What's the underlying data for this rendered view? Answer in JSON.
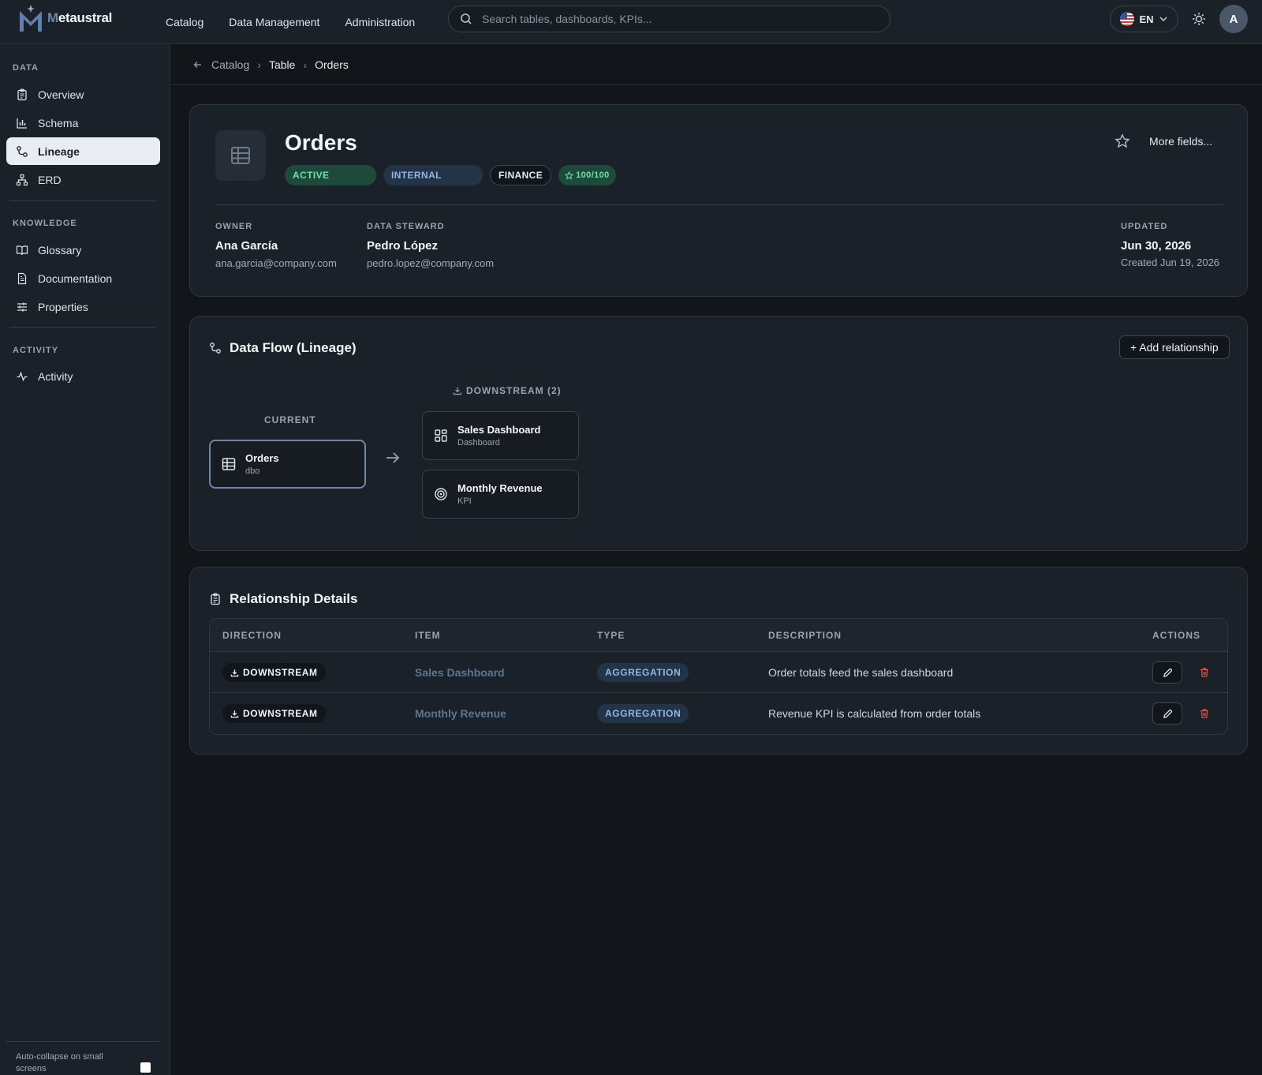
{
  "app": {
    "brand_initial": "M",
    "brand_rest": "etaustral"
  },
  "nav": [
    "Catalog",
    "Data Management",
    "Administration"
  ],
  "search": {
    "placeholder": "Search tables, dashboards, KPIs..."
  },
  "lang": {
    "code": "EN"
  },
  "user": {
    "initial": "A"
  },
  "sidebar": {
    "sections": [
      {
        "title": "DATA",
        "items": [
          "Overview",
          "Schema",
          "Lineage",
          "ERD"
        ]
      },
      {
        "title": "KNOWLEDGE",
        "items": [
          "Glossary",
          "Documentation",
          "Properties"
        ]
      },
      {
        "title": "ACTIVITY",
        "items": [
          "Activity"
        ]
      }
    ],
    "active": "Lineage",
    "auto_collapse_label": "Auto-collapse on small screens"
  },
  "breadcrumb": [
    "Catalog",
    "Table",
    "Orders"
  ],
  "asset": {
    "title": "Orders",
    "badges": {
      "status": "ACTIVE",
      "classification": "INTERNAL",
      "domain": "FINANCE",
      "score": "100/100"
    },
    "more_fields": "More fields...",
    "owner": {
      "label": "OWNER",
      "name": "Ana García",
      "email": "ana.garcia@company.com"
    },
    "steward": {
      "label": "DATA STEWARD",
      "name": "Pedro López",
      "email": "pedro.lopez@company.com"
    },
    "updated": {
      "label": "UPDATED",
      "date": "Jun 30, 2026",
      "created": "Created Jun 19, 2026"
    }
  },
  "lineage": {
    "title": "Data Flow (Lineage)",
    "add_button": "+ Add relationship",
    "current_label": "CURRENT",
    "downstream_label": "DOWNSTREAM (2)",
    "current": {
      "name": "Orders",
      "schema": "dbo"
    },
    "downstream": [
      {
        "name": "Sales Dashboard",
        "type": "Dashboard"
      },
      {
        "name": "Monthly Revenue",
        "type": "KPI"
      }
    ]
  },
  "relationships": {
    "title": "Relationship Details",
    "columns": [
      "DIRECTION",
      "ITEM",
      "TYPE",
      "DESCRIPTION",
      "ACTIONS"
    ],
    "rows": [
      {
        "direction": "DOWNSTREAM",
        "item": "Sales Dashboard",
        "type": "AGGREGATION",
        "description": "Order totals feed the sales dashboard"
      },
      {
        "direction": "DOWNSTREAM",
        "item": "Monthly Revenue",
        "type": "AGGREGATION",
        "description": "Revenue KPI is calculated from order totals"
      }
    ]
  },
  "colors": {
    "accent": "#6f86a8",
    "success": "#6ee0a8",
    "info": "#8eb6e6",
    "danger": "#e0524f"
  }
}
